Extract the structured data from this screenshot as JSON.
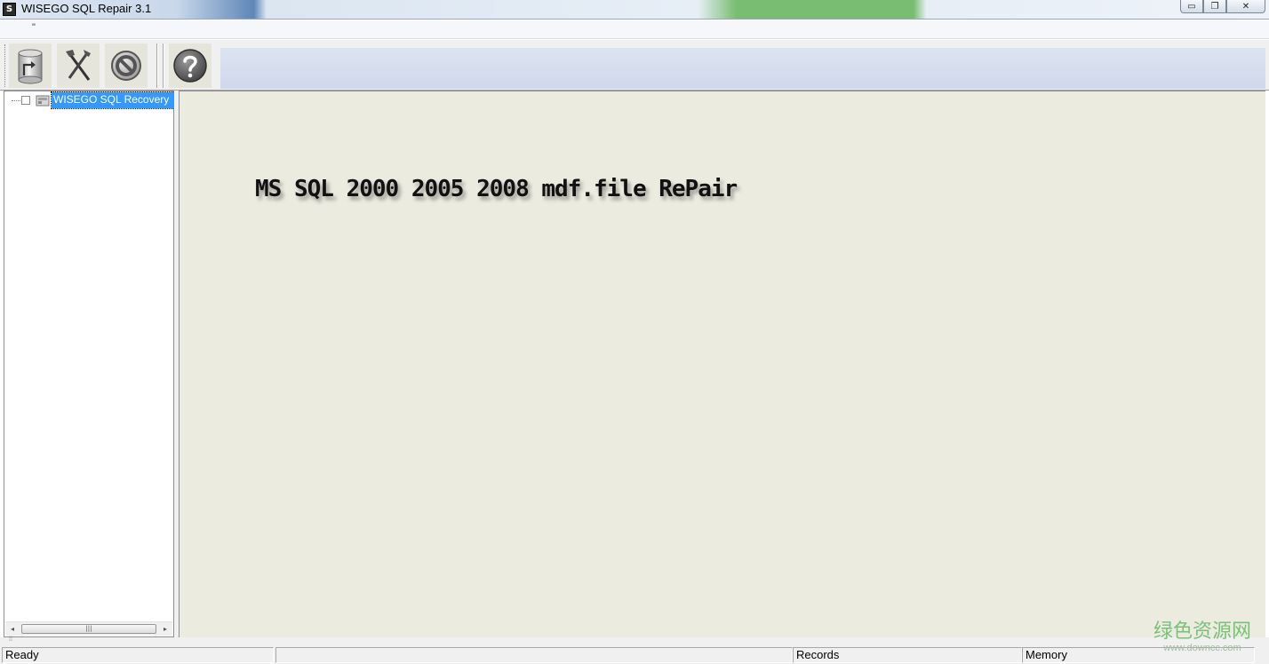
{
  "window": {
    "title": "WISEGO SQL Repair 3.1",
    "app_icon_letter": "S",
    "minimize_glyph": "▭",
    "restore_glyph": "❐",
    "close_glyph": "✕"
  },
  "menubar": {
    "grip": "\""
  },
  "toolbar": {
    "buttons": [
      {
        "icon": "database-open-icon"
      },
      {
        "icon": "repair-tools-icon"
      },
      {
        "icon": "stop-icon"
      },
      {
        "icon": "help-icon"
      }
    ]
  },
  "tree": {
    "root_label": "WISEGO  SQL Recovery"
  },
  "scrollbar": {
    "left_arrow": "◂",
    "right_arrow": "▸",
    "thumb_grip": "|||"
  },
  "content": {
    "banner": "MS SQL 2000 2005 2008 mdf.file RePair"
  },
  "statusbar": {
    "ready": "Ready",
    "middle": "",
    "records": "Records",
    "memory": "Memory"
  },
  "watermark": {
    "chinese": "绿色资源网",
    "url": "www.downcc.com"
  }
}
